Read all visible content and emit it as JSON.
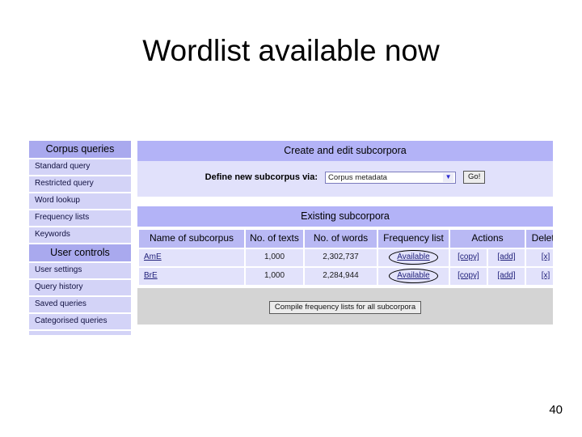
{
  "slide": {
    "title": "Wordlist available now",
    "page_number": "40"
  },
  "sidebar": {
    "sections": [
      {
        "header": "Corpus queries",
        "items": [
          {
            "label": "Standard query"
          },
          {
            "label": "Restricted query"
          },
          {
            "label": "Word lookup"
          },
          {
            "label": "Frequency lists"
          },
          {
            "label": "Keywords"
          }
        ]
      },
      {
        "header": "User controls",
        "items": [
          {
            "label": "User settings"
          },
          {
            "label": "Query history"
          },
          {
            "label": "Saved queries"
          },
          {
            "label": "Categorised queries"
          },
          {
            "label": ""
          }
        ]
      }
    ]
  },
  "create_panel": {
    "header": "Create and edit subcorpora",
    "define_label": "Define new subcorpus via:",
    "select": {
      "value": "Corpus metadata",
      "arrow_icon": "chevron-down-icon"
    },
    "go_button": "Go!"
  },
  "existing_panel": {
    "header": "Existing subcorpora",
    "columns": [
      "Name of subcorpus",
      "No. of texts",
      "No. of words",
      "Frequency list",
      "Actions",
      "Delete"
    ],
    "rows": [
      {
        "name": "AmE",
        "texts": "1,000",
        "words": "2,302,737",
        "frequency_list": "Available",
        "action_copy": "[copy]",
        "action_add": "[add]",
        "delete": "[x]"
      },
      {
        "name": "BrE",
        "texts": "1,000",
        "words": "2,284,944",
        "frequency_list": "Available",
        "action_copy": "[copy]",
        "action_add": "[add]",
        "delete": "[x]"
      }
    ],
    "compile_button": "Compile frequency lists for all subcorpora"
  },
  "colors": {
    "sidebar_header": "#a9a9ee",
    "sidebar_item": "#d3d3f7",
    "panel_header": "#b3b3f7",
    "panel_body": "#e1e1fb",
    "table_header": "#b9b9f4",
    "table_cell": "#e2e2fb",
    "footer": "#d4d4d4",
    "link": "#20207a"
  }
}
